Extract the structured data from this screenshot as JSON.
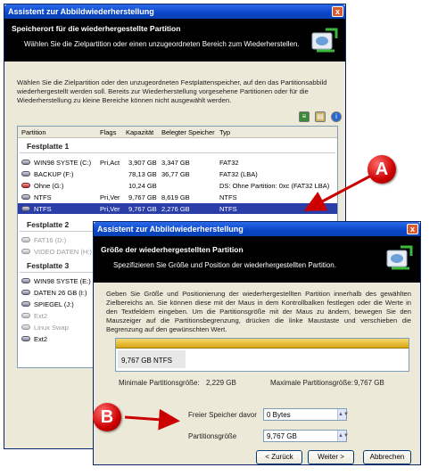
{
  "window1": {
    "title": "Assistent zur Abbildwiederherstellung",
    "close": "x",
    "banner_title": "Speicherort für die wiederhergestellte Partition",
    "banner_subtitle": "Wählen Sie die Zielpartition oder einen unzugeordneten Bereich zum Wiederherstellen.",
    "description": "Wählen Sie die Zielpartition oder den unzugeordneten Festplattenspeicher, auf den das Partitionsabbild wiederhergestellt werden soll. Bereits zur Wiederherstellung vorgesehene Partitionen oder für die Wiederherstellung zu kleine Bereiche können nicht ausgewählt werden.",
    "columns": [
      "Partition",
      "Flags",
      "Kapazität",
      "Belegter Speicher",
      "Typ"
    ],
    "disks": [
      {
        "label": "Festplatte 1",
        "rows": [
          {
            "name": "WIN98 SYSTE (C:)",
            "flags": "Pri,Act",
            "capacity": "3,907 GB",
            "used": "3,347 GB",
            "type": "FAT32",
            "state": "normal"
          },
          {
            "name": "BACKUP (F:)",
            "flags": "",
            "capacity": "78,13 GB",
            "used": "36,77 GB",
            "type": "FAT32 (LBA)",
            "state": "normal"
          },
          {
            "name": "Ohne (G:)",
            "flags": "",
            "capacity": "10,24 GB",
            "used": "",
            "type": "DS: Ohne Partition: 0xc (FAT32 LBA)",
            "state": "normal"
          },
          {
            "name": "NTFS",
            "flags": "Pri,Ver",
            "capacity": "9,767 GB",
            "used": "8,619 GB",
            "type": "NTFS",
            "state": "normal"
          },
          {
            "name": "NTFS",
            "flags": "Pri,Ver",
            "capacity": "9,767 GB",
            "used": "2,276 GB",
            "type": "NTFS",
            "state": "selected"
          }
        ]
      },
      {
        "label": "Festplatte 2",
        "rows": [
          {
            "name": "FAT16 (D:)",
            "state": "dim"
          },
          {
            "name": "VIDEO DATEN (H:)",
            "state": "dim"
          }
        ]
      },
      {
        "label": "Festplatte 3",
        "rows": [
          {
            "name": "WIN98 SYSTE (E:)",
            "state": "normal"
          },
          {
            "name": "DATEN 26 GB (I:)",
            "state": "normal"
          },
          {
            "name": "SPIEGEL (J:)",
            "state": "normal"
          },
          {
            "name": "Ext2",
            "state": "dim"
          },
          {
            "name": "Linux Swap",
            "state": "dim"
          },
          {
            "name": "Ext2",
            "state": "normal"
          }
        ]
      }
    ]
  },
  "window2": {
    "title": "Assistent zur Abbildwiederherstellung",
    "close": "x",
    "banner_title": "Größe der wiederhergestellten Partition",
    "banner_subtitle": "Spezifizieren Sie Größe und Position der wiederhergestellten Partition.",
    "description": "Geben Sie Größe und Positionierung der wiederhergestellten Partition innerhalb des gewählten Zielbereichs an. Sie können diese mit der Maus in dem Kontrollbalken festlegen oder die Werte in den Textfeldern eingeben. Um die Partitionsgröße mit der Maus zu ändern, bewegen Sie den Mauszeiger auf die Partitionsbegrenzung, drücken die linke Maustaste und verschieben die Begrenzung auf den gewünschten Wert.",
    "partition_label": "9,767 GB  NTFS",
    "min_label": "Minimale Partitionsgröße:",
    "min_value": "2,229 GB",
    "max_label": "Maximale Partitionsgröße:",
    "max_value": "9,767 GB",
    "free_before_label": "Freier Speicher davor",
    "free_before_value": "0 Bytes",
    "size_label": "Partitionsgröße",
    "size_value": "9,767 GB",
    "btn_back": "< Zurück",
    "btn_next": "Weiter >",
    "btn_cancel": "Abbrechen"
  },
  "callouts": {
    "a": "A",
    "b": "B"
  },
  "colors": {
    "selection": "#2b3ea8",
    "titlebar": "#0a46c8",
    "callout": "#cc0000"
  }
}
